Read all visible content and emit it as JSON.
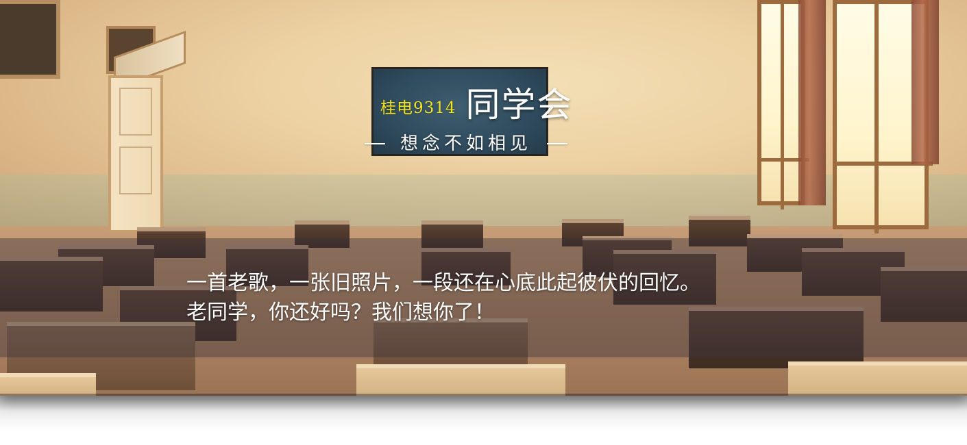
{
  "banner": {
    "title_prefix": "桂电9314",
    "title_main": "同学会",
    "subtitle": "想念不如相见",
    "caption_line_1": "一首老歌，一张旧照片，一段还在心底此起彼伏的回忆。",
    "caption_line_2": "老同学，你还好吗？我们想你了！"
  },
  "colors": {
    "title_prefix": "#f3e21c",
    "title_main": "#ffffff",
    "blackboard": "#2f4b5d",
    "caption_overlay": "#3c323c"
  }
}
